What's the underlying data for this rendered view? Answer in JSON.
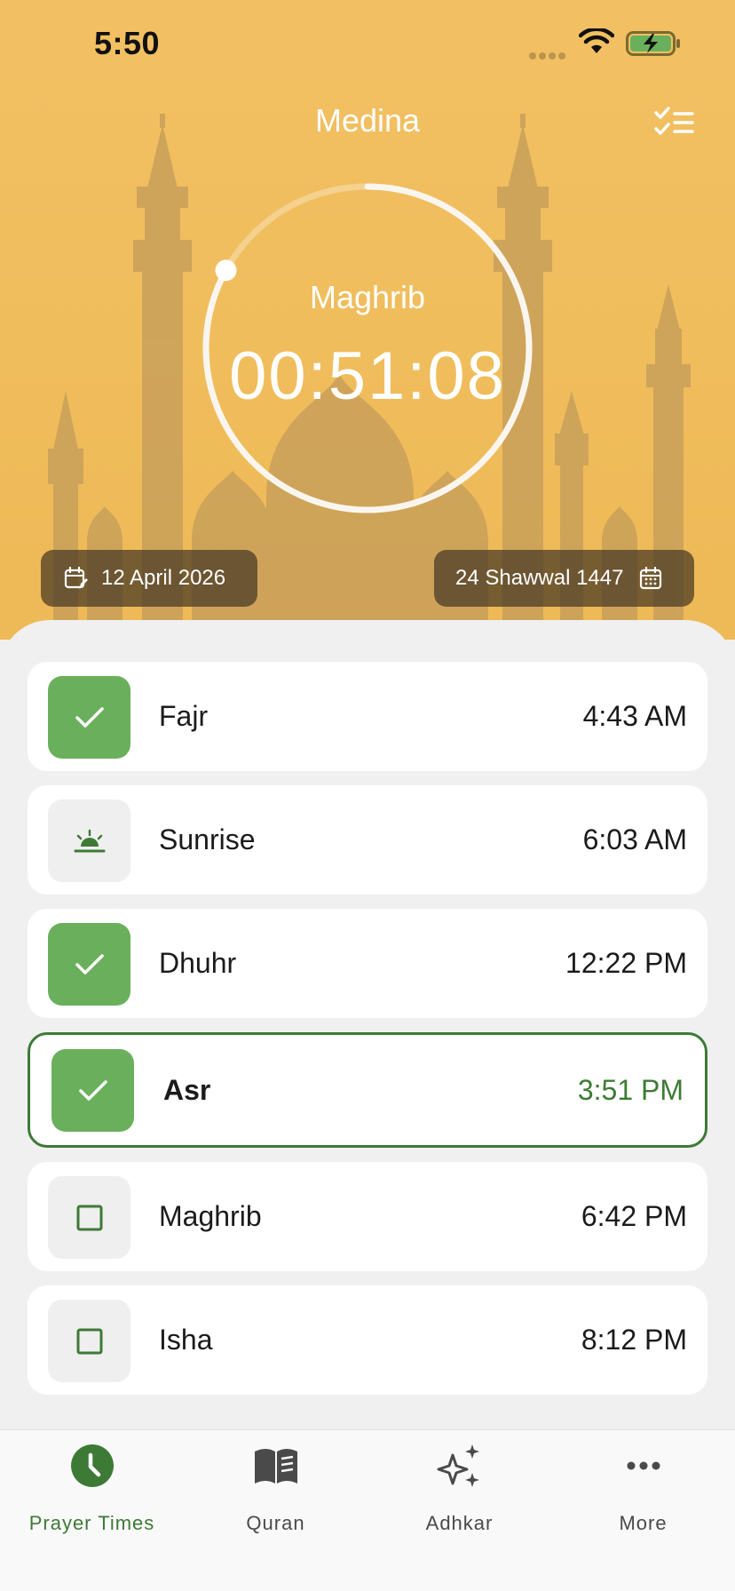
{
  "status_bar": {
    "time": "5:50"
  },
  "header": {
    "city": "Medina"
  },
  "countdown": {
    "prayer": "Maghrib",
    "remaining": "00:51:08",
    "progress_fraction": 0.83
  },
  "dates": {
    "gregorian": "12 April 2026",
    "hijri": "24 Shawwal 1447"
  },
  "prayers": [
    {
      "name": "Fajr",
      "time": "4:43 AM",
      "status": "done",
      "icon": "check-icon"
    },
    {
      "name": "Sunrise",
      "time": "6:03 AM",
      "status": "info",
      "icon": "sunrise-icon"
    },
    {
      "name": "Dhuhr",
      "time": "12:22 PM",
      "status": "done",
      "icon": "check-icon"
    },
    {
      "name": "Asr",
      "time": "3:51 PM",
      "status": "done",
      "icon": "check-icon",
      "current": true
    },
    {
      "name": "Maghrib",
      "time": "6:42 PM",
      "status": "pending",
      "icon": "checkbox-icon"
    },
    {
      "name": "Isha",
      "time": "8:12 PM",
      "status": "pending",
      "icon": "checkbox-icon"
    }
  ],
  "tabs": [
    {
      "label": "Prayer Times",
      "icon": "clock-icon",
      "active": true
    },
    {
      "label": "Quran",
      "icon": "book-icon",
      "active": false
    },
    {
      "label": "Adhkar",
      "icon": "sparkles-icon",
      "active": false
    },
    {
      "label": "More",
      "icon": "more-icon",
      "active": false
    }
  ],
  "colors": {
    "header_bg": "#f0bd5c",
    "accent_green": "#3d7a35",
    "done_green": "#6ab05c",
    "pill_bg": "#463723"
  }
}
